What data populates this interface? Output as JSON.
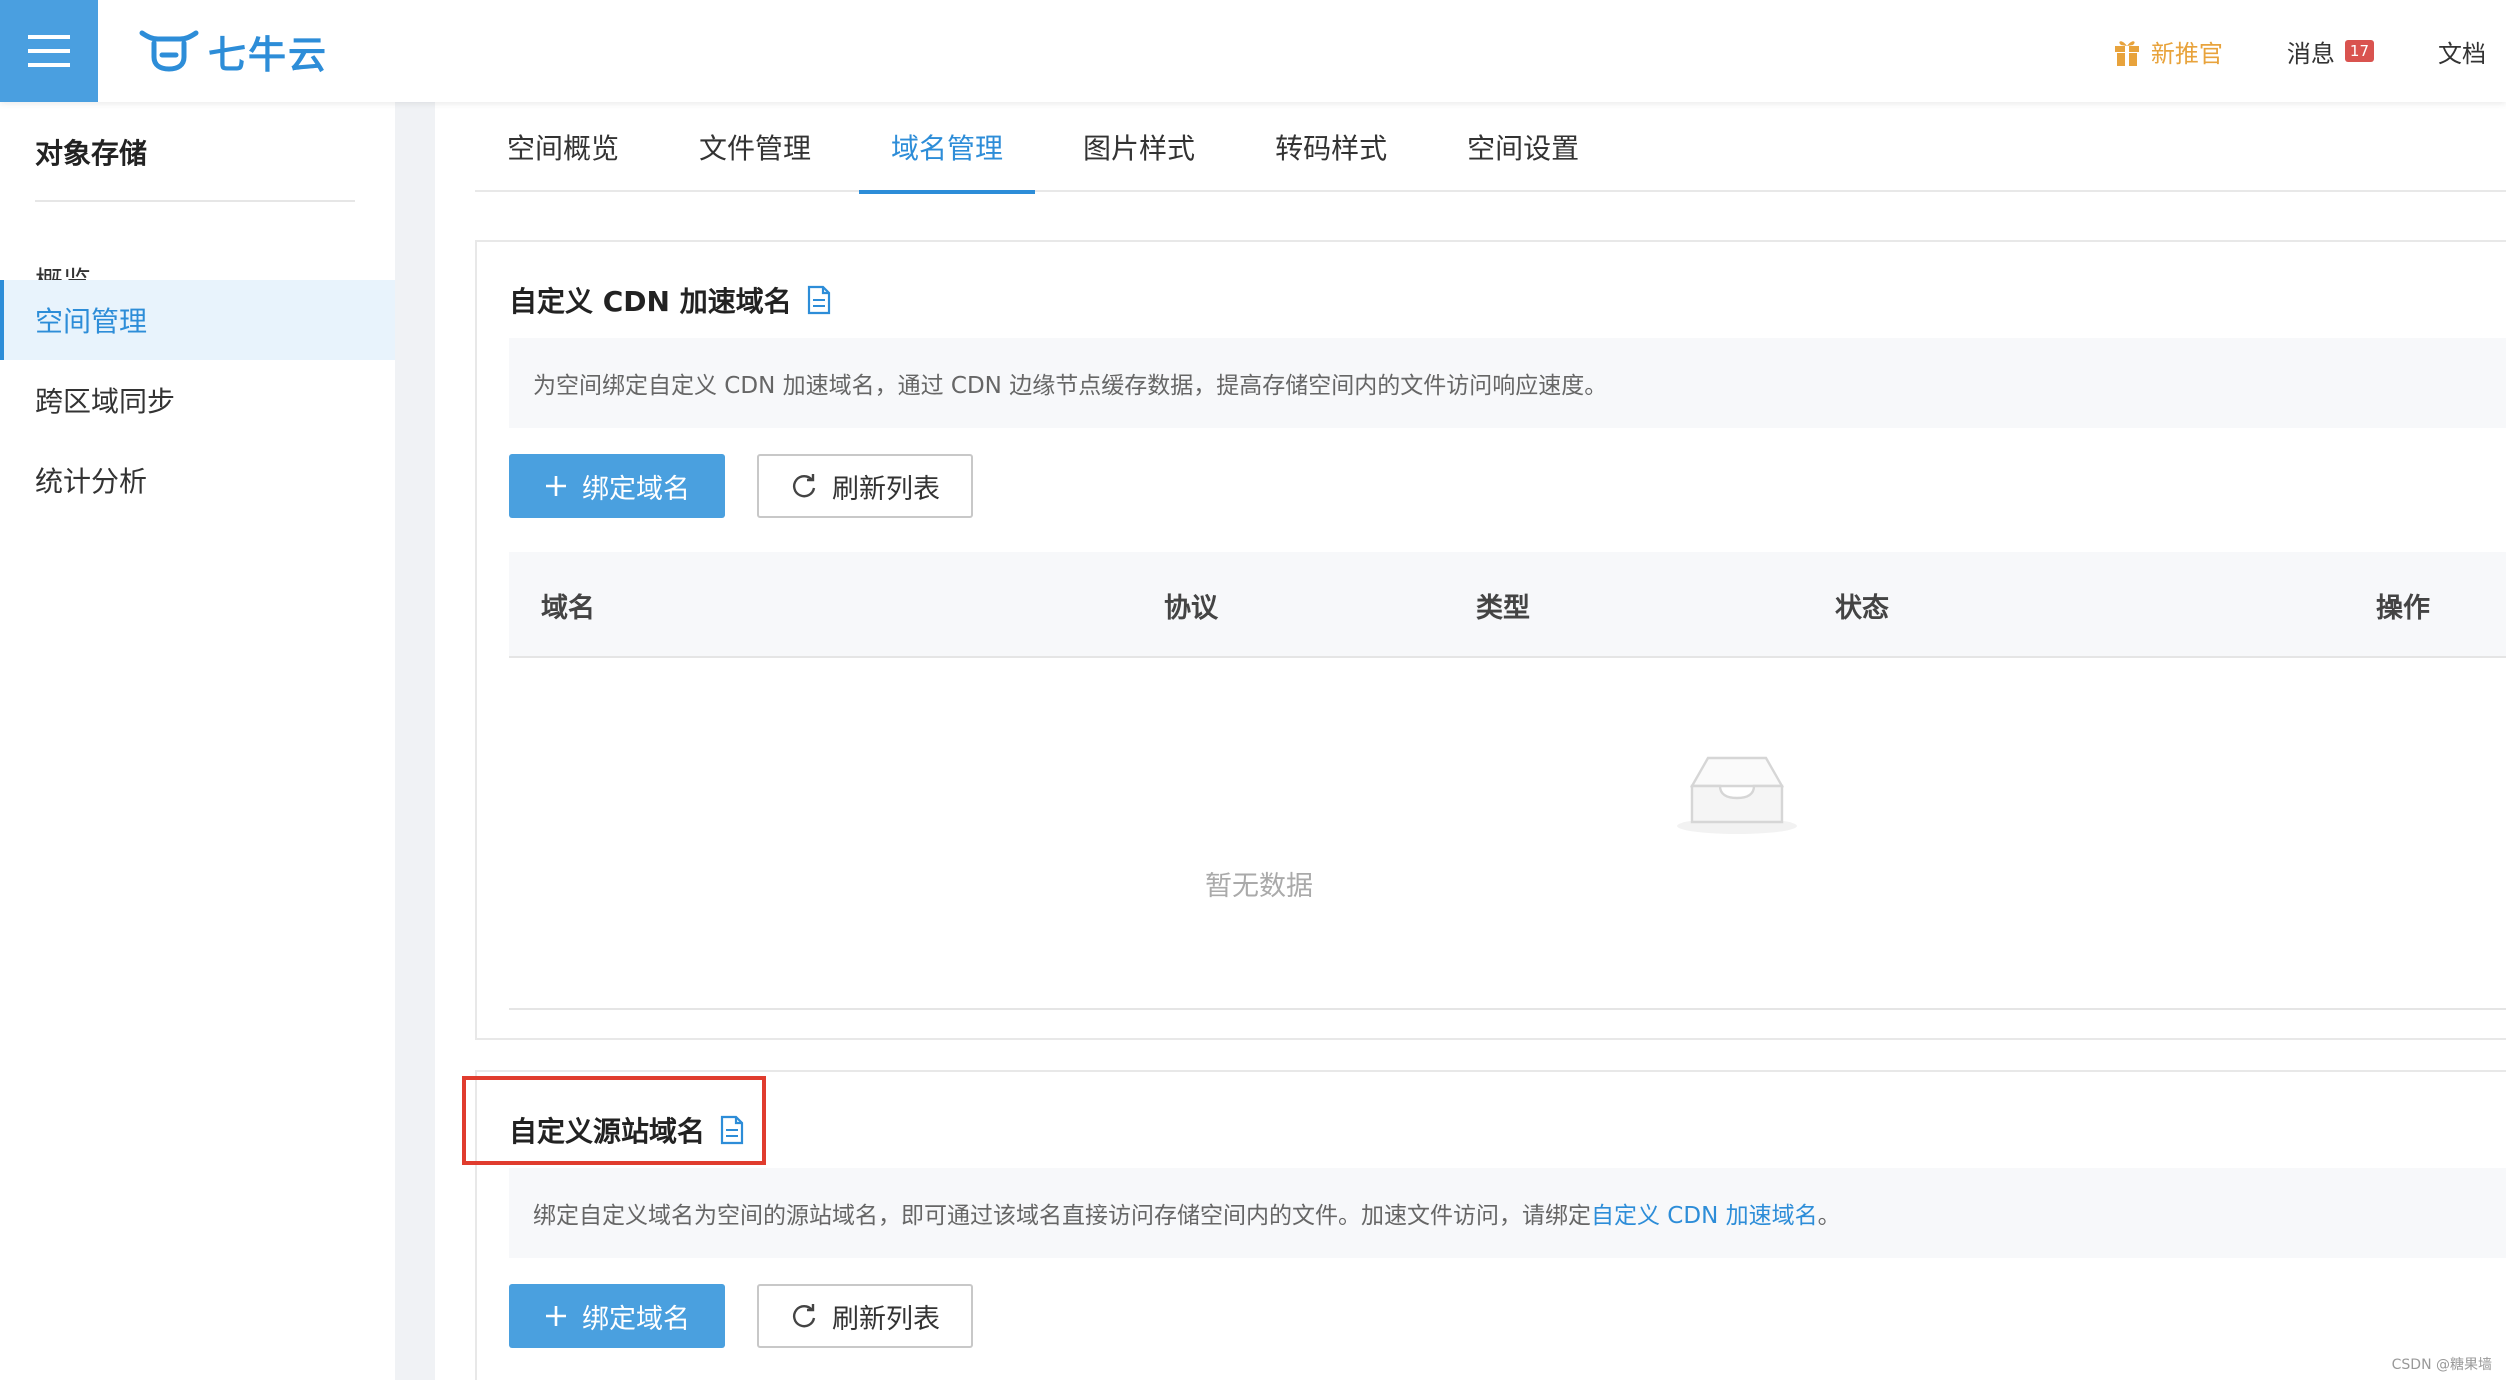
{
  "header": {
    "logo_text": "七牛云",
    "promo_label": "新推官",
    "messages_label": "消息",
    "messages_count": "17",
    "docs_label": "文档"
  },
  "sidebar": {
    "title": "对象存储",
    "items": [
      {
        "label": "概览",
        "active": false
      },
      {
        "label": "空间管理",
        "active": true
      },
      {
        "label": "跨区域同步",
        "active": false
      },
      {
        "label": "统计分析",
        "active": false
      }
    ]
  },
  "tabs": [
    {
      "label": "空间概览",
      "active": false
    },
    {
      "label": "文件管理",
      "active": false
    },
    {
      "label": "域名管理",
      "active": true
    },
    {
      "label": "图片样式",
      "active": false
    },
    {
      "label": "转码样式",
      "active": false
    },
    {
      "label": "空间设置",
      "active": false
    }
  ],
  "cdn_section": {
    "title": "自定义 CDN 加速域名",
    "description": "为空间绑定自定义 CDN 加速域名，通过 CDN 边缘节点缓存数据，提高存储空间内的文件访问响应速度。",
    "bind_button": "绑定域名",
    "refresh_button": "刷新列表",
    "columns": [
      "域名",
      "协议",
      "类型",
      "状态",
      "操作"
    ],
    "empty_text": "暂无数据"
  },
  "origin_section": {
    "title": "自定义源站域名",
    "description_prefix": "绑定自定义域名为空间的源站域名，即可通过该域名直接访问存储空间内的文件。加速文件访问，请绑定",
    "description_link": "自定义 CDN 加速域名",
    "description_suffix": "。",
    "bind_button": "绑定域名",
    "refresh_button": "刷新列表"
  },
  "watermark": "CSDN @糖果墙",
  "colors": {
    "accent": "#2d8dd8",
    "menu_bg": "#4a9fe0",
    "primary_button": "#4aa0df",
    "promo": "#e8a33c",
    "badge": "#d9534f",
    "highlight_border": "#e03c2e"
  }
}
